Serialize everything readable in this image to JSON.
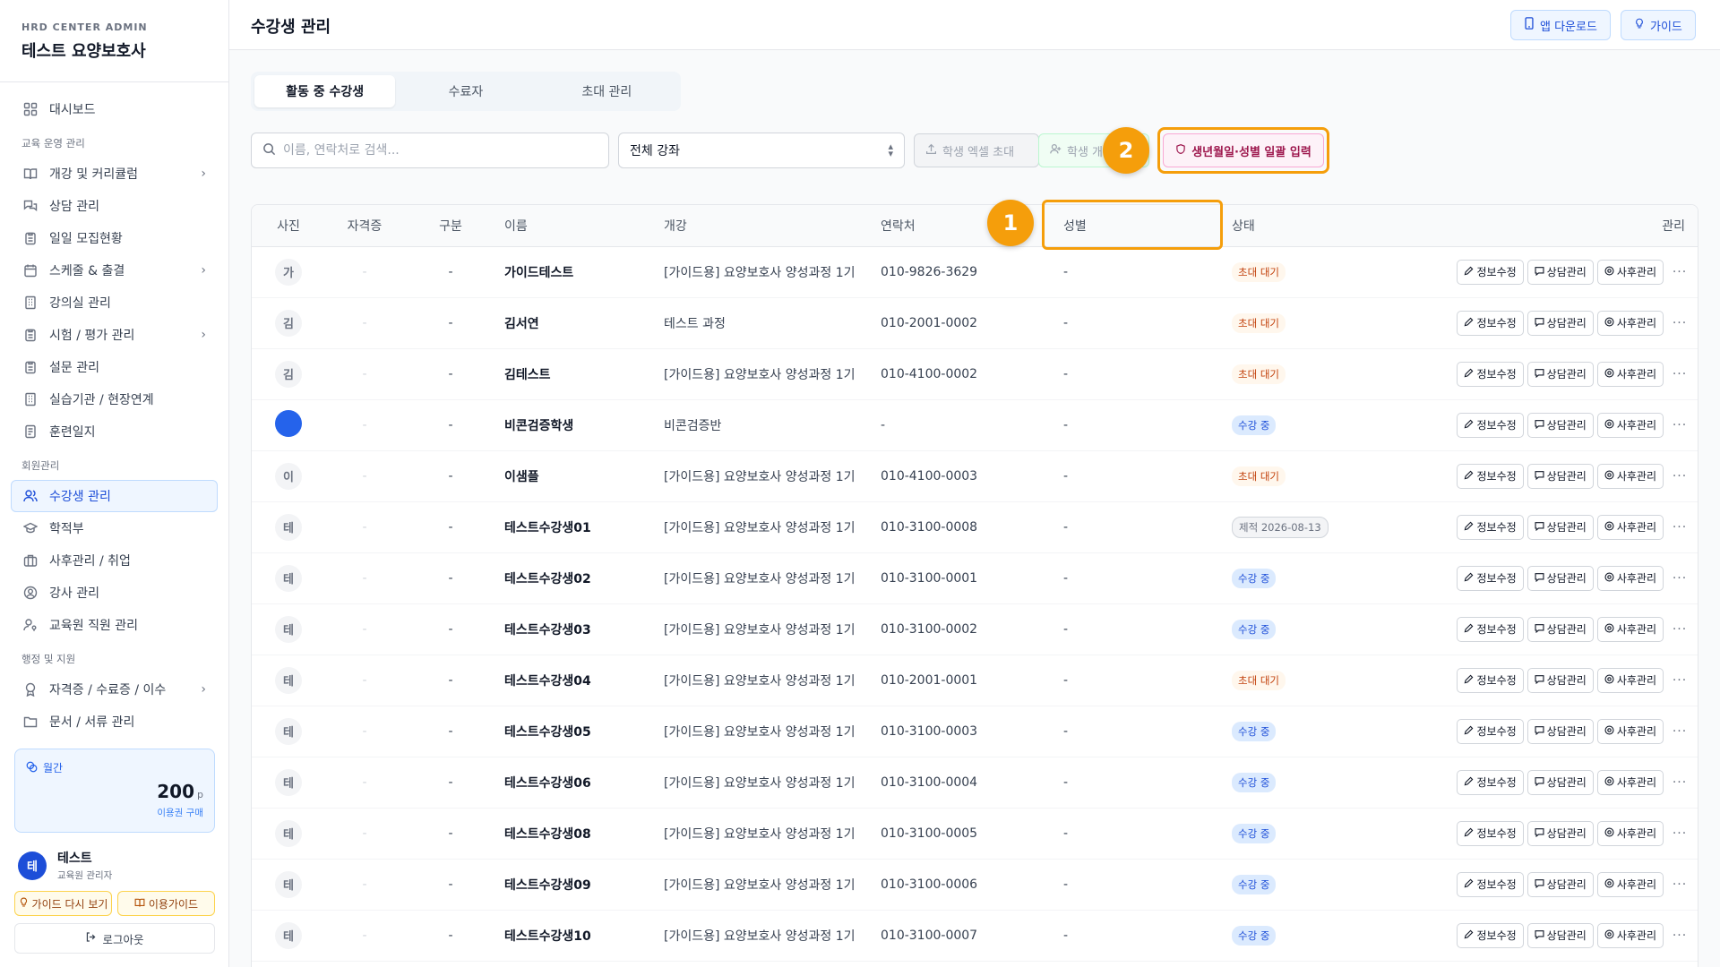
{
  "brand": {
    "sub": "HRD CENTER ADMIN",
    "title": "테스트 요양보호사"
  },
  "sidebar": {
    "dashboard": "대시보드",
    "section_edu": "교육 운영 관리",
    "edu_items": [
      {
        "label": "개강 및 커리큘럼",
        "chevron": true
      },
      {
        "label": "상담 관리",
        "chevron": false
      },
      {
        "label": "일일 모집현황",
        "chevron": false
      },
      {
        "label": "스케줄 & 출결",
        "chevron": true
      },
      {
        "label": "강의실 관리",
        "chevron": false
      },
      {
        "label": "시험 / 평가 관리",
        "chevron": true
      },
      {
        "label": "설문 관리",
        "chevron": false
      },
      {
        "label": "실습기관 / 현장연계",
        "chevron": false
      },
      {
        "label": "훈련일지",
        "chevron": false
      }
    ],
    "section_member": "회원관리",
    "member_items": [
      {
        "label": "수강생 관리",
        "active": true
      },
      {
        "label": "학적부"
      },
      {
        "label": "사후관리 / 취업"
      },
      {
        "label": "강사 관리"
      },
      {
        "label": "교육원 직원 관리"
      }
    ],
    "section_admin": "행정 및 지원",
    "admin_items": [
      {
        "label": "자격증 / 수료증 / 이수",
        "chevron": true
      },
      {
        "label": "문서 / 서류 관리"
      }
    ],
    "credit": {
      "label": "월간",
      "amount": "200",
      "unit": "p",
      "buy": "이용권 구매"
    },
    "user": {
      "initial": "테",
      "name": "테스트",
      "role": "교육원 관리자"
    },
    "guide_again": "가이드 다시 보기",
    "usage_guide": "이용가이드",
    "logout": "로그아웃"
  },
  "header": {
    "title": "수강생 관리",
    "app_download": "앱 다운로드",
    "guide": "가이드"
  },
  "tabs": [
    "활동 중 수강생",
    "수료자",
    "초대 관리"
  ],
  "toolbar": {
    "search_placeholder": "이름, 연락처로 검색...",
    "course_select": "전체 강좌",
    "excel_invite": "학생 엑셀 초대",
    "individual": "학생 개별",
    "bulk_input": "생년월일·성별 일괄 입력"
  },
  "annotations": [
    "1",
    "2"
  ],
  "table": {
    "headers": [
      "사진",
      "자격증",
      "구분",
      "이름",
      "개강",
      "연락처",
      "성별",
      "상태",
      "관리"
    ],
    "actions": [
      "정보수정",
      "상담관리",
      "사후관리"
    ],
    "rows": [
      {
        "avatar": "가",
        "name": "가이드테스트",
        "course": "[가이드용] 요양보호사 양성과정 1기",
        "phone": "010-9826-3629",
        "gender": "-",
        "status": "초대 대기",
        "status_type": "wait"
      },
      {
        "avatar": "김",
        "name": "김서연",
        "course": "테스트 과정",
        "phone": "010-2001-0002",
        "gender": "-",
        "status": "초대 대기",
        "status_type": "wait"
      },
      {
        "avatar": "김",
        "name": "김테스트",
        "course": "[가이드용] 요양보호사 양성과정 1기",
        "phone": "010-4100-0002",
        "gender": "-",
        "status": "초대 대기",
        "status_type": "wait"
      },
      {
        "avatar": "",
        "name": "비콘검증학생",
        "course": "비콘검증반",
        "phone": "-",
        "gender": "-",
        "status": "수강 중",
        "status_type": "active"
      },
      {
        "avatar": "이",
        "name": "이샘플",
        "course": "[가이드용] 요양보호사 양성과정 1기",
        "phone": "010-4100-0003",
        "gender": "-",
        "status": "초대 대기",
        "status_type": "wait"
      },
      {
        "avatar": "테",
        "name": "테스트수강생01",
        "course": "[가이드용] 요양보호사 양성과정 1기",
        "phone": "010-3100-0008",
        "gender": "-",
        "status": "제적 2026-08-13",
        "status_type": "expel"
      },
      {
        "avatar": "테",
        "name": "테스트수강생02",
        "course": "[가이드용] 요양보호사 양성과정 1기",
        "phone": "010-3100-0001",
        "gender": "-",
        "status": "수강 중",
        "status_type": "active"
      },
      {
        "avatar": "테",
        "name": "테스트수강생03",
        "course": "[가이드용] 요양보호사 양성과정 1기",
        "phone": "010-3100-0002",
        "gender": "-",
        "status": "수강 중",
        "status_type": "active"
      },
      {
        "avatar": "테",
        "name": "테스트수강생04",
        "course": "[가이드용] 요양보호사 양성과정 1기",
        "phone": "010-2001-0001",
        "gender": "-",
        "status": "초대 대기",
        "status_type": "wait"
      },
      {
        "avatar": "테",
        "name": "테스트수강생05",
        "course": "[가이드용] 요양보호사 양성과정 1기",
        "phone": "010-3100-0003",
        "gender": "-",
        "status": "수강 중",
        "status_type": "active"
      },
      {
        "avatar": "테",
        "name": "테스트수강생06",
        "course": "[가이드용] 요양보호사 양성과정 1기",
        "phone": "010-3100-0004",
        "gender": "-",
        "status": "수강 중",
        "status_type": "active"
      },
      {
        "avatar": "테",
        "name": "테스트수강생08",
        "course": "[가이드용] 요양보호사 양성과정 1기",
        "phone": "010-3100-0005",
        "gender": "-",
        "status": "수강 중",
        "status_type": "active"
      },
      {
        "avatar": "테",
        "name": "테스트수강생09",
        "course": "[가이드용] 요양보호사 양성과정 1기",
        "phone": "010-3100-0006",
        "gender": "-",
        "status": "수강 중",
        "status_type": "active"
      },
      {
        "avatar": "테",
        "name": "테스트수강생10",
        "course": "[가이드용] 요양보호사 양성과정 1기",
        "phone": "010-3100-0007",
        "gender": "-",
        "status": "수강 중",
        "status_type": "active"
      }
    ]
  }
}
